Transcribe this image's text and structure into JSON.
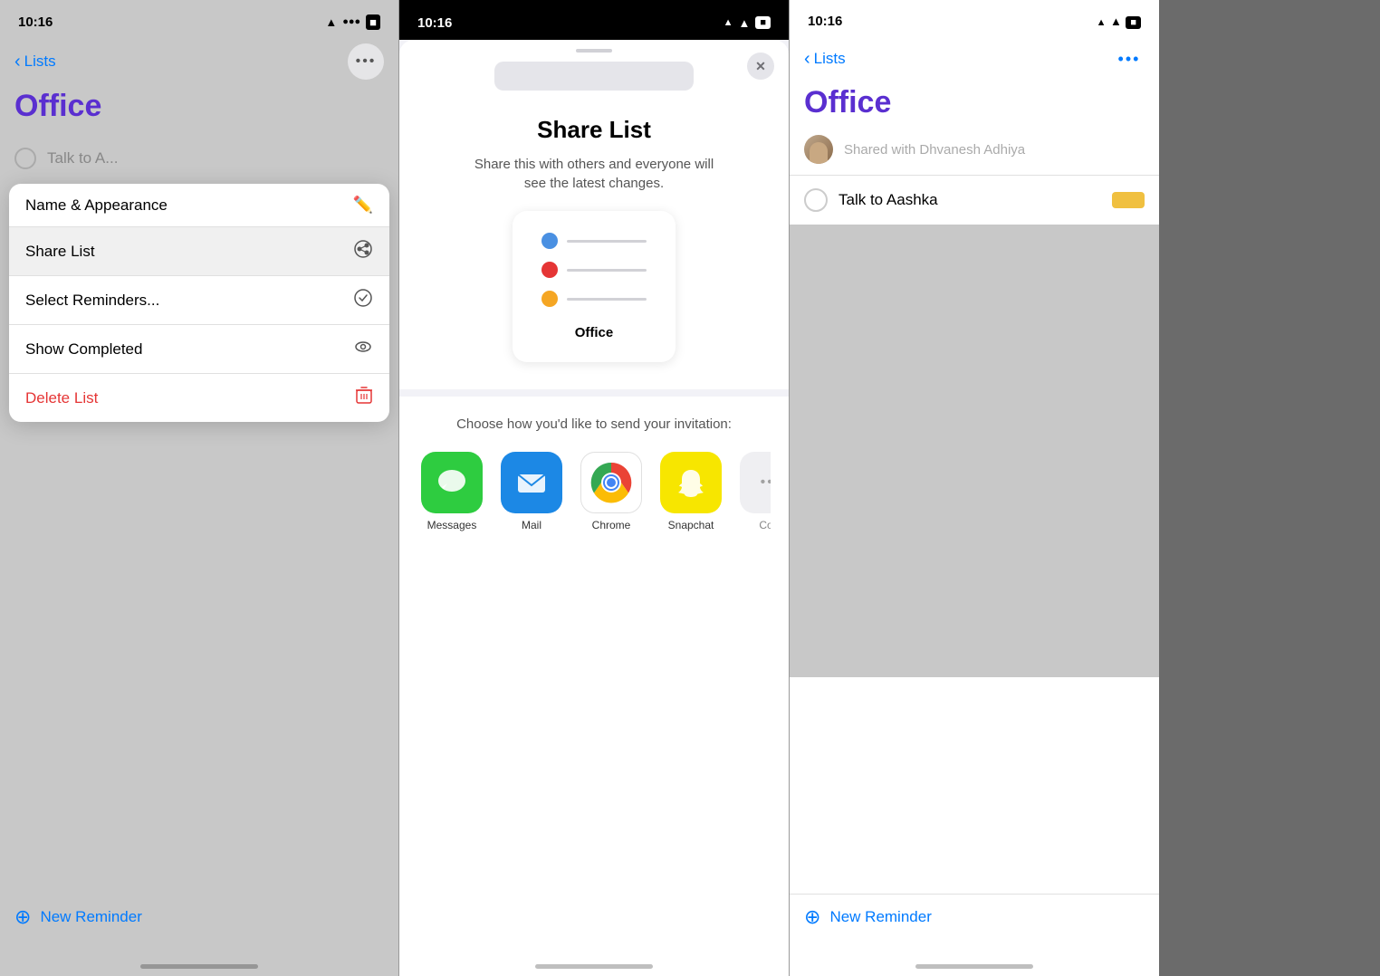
{
  "left_phone": {
    "status_bar": {
      "time": "10:16",
      "wifi": "wifi",
      "battery": "battery"
    },
    "back_label": "Lists",
    "title": "Office",
    "dropdown": {
      "items": [
        {
          "id": "name-appearance",
          "label": "Name & Appearance",
          "icon": "pencil",
          "active": false,
          "red": false
        },
        {
          "id": "share-list",
          "label": "Share List",
          "icon": "share-icon",
          "active": true,
          "red": false
        },
        {
          "id": "select-reminders",
          "label": "Select Reminders...",
          "icon": "checkmark-circle",
          "active": false,
          "red": false
        },
        {
          "id": "show-completed",
          "label": "Show Completed",
          "icon": "eye",
          "active": false,
          "red": false
        },
        {
          "id": "delete-list",
          "label": "Delete List",
          "icon": "trash",
          "active": false,
          "red": true
        }
      ]
    },
    "reminder_item": "Talk to A...",
    "new_reminder_label": "New Reminder"
  },
  "middle_phone": {
    "status_bar": {
      "time": "10:16",
      "wifi": "wifi",
      "battery": "battery"
    },
    "modal": {
      "title": "Share List",
      "subtitle": "Share this with others and everyone will see the latest changes.",
      "list_name": "Office",
      "list_items": [
        {
          "color": "#4a90e2"
        },
        {
          "color": "#e53535"
        },
        {
          "color": "#f5a623"
        }
      ],
      "share_section_label": "Choose how you'd like to send your invitation:",
      "apps": [
        {
          "id": "messages",
          "label": "Messages",
          "emoji": "💬",
          "color_class": "icon-messages"
        },
        {
          "id": "mail",
          "label": "Mail",
          "emoji": "✉️",
          "color_class": "icon-mail"
        },
        {
          "id": "chrome",
          "label": "Chrome",
          "emoji": "chrome",
          "color_class": "icon-chrome"
        },
        {
          "id": "snapchat",
          "label": "Snapchat",
          "emoji": "👻",
          "color_class": "icon-snapchat"
        },
        {
          "id": "more",
          "label": "Co...",
          "emoji": "•••",
          "color_class": "icon-more"
        }
      ]
    }
  },
  "right_phone": {
    "status_bar": {
      "time": "10:16"
    },
    "back_label": "Lists",
    "title": "Office",
    "shared_with": "Shared with Dhvanesh Adhiya",
    "reminder_item": "Talk to Aashka",
    "new_reminder_label": "New Reminder"
  }
}
